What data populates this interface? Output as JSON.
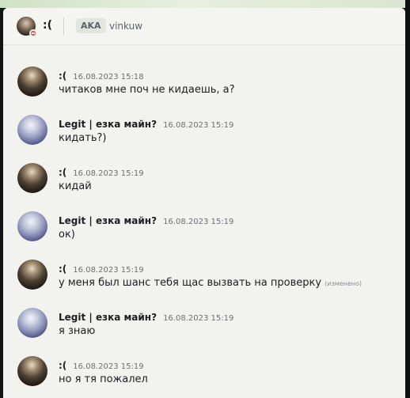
{
  "header": {
    "channel_name": ":(",
    "aka_label": "AKA",
    "handle": "vinkuw"
  },
  "messages": [
    {
      "author": ":(",
      "time": "16.08.2023 15:18",
      "text": "читаков мне поч не кидаешь, а?",
      "avatar": "dark"
    },
    {
      "author": "Legit | езка майн?",
      "time": "16.08.2023 15:19",
      "text": "кидать?)",
      "avatar": "blue"
    },
    {
      "author": ":(",
      "time": "16.08.2023 15:19",
      "text": "кидай",
      "avatar": "dark"
    },
    {
      "author": "Legit | езка майн?",
      "time": "16.08.2023 15:19",
      "text": "ок)",
      "avatar": "blue"
    },
    {
      "author": ":(",
      "time": "16.08.2023 15:19",
      "text": "у меня был шанс тебя щас вызвать на проверку",
      "edited": "(изменено)",
      "avatar": "dark"
    },
    {
      "author": "Legit | езка майн?",
      "time": "16.08.2023 15:19",
      "text": "я знаю",
      "avatar": "blue"
    },
    {
      "author": ":(",
      "time": "16.08.2023 15:19",
      "text": "но я тя пожалел",
      "avatar": "dark"
    }
  ]
}
